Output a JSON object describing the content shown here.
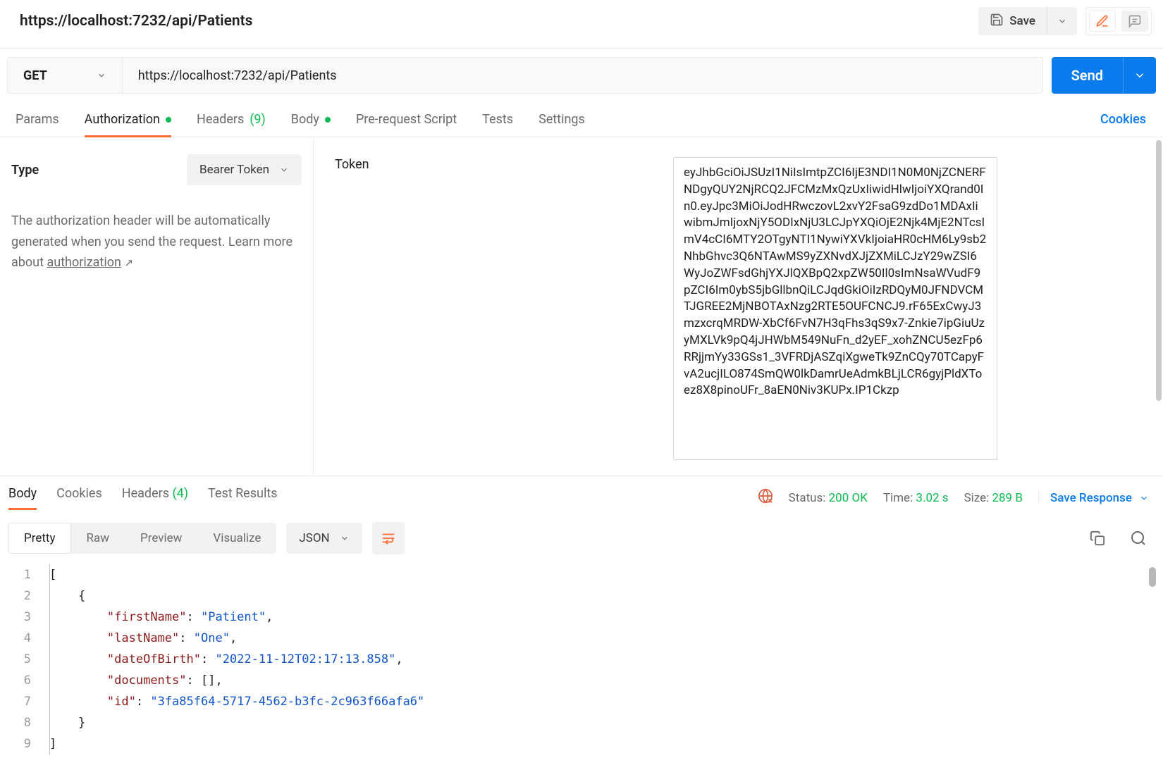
{
  "header": {
    "title": "https://localhost:7232/api/Patients",
    "save_label": "Save"
  },
  "request": {
    "method": "GET",
    "url": "https://localhost:7232/api/Patients",
    "send_label": "Send"
  },
  "req_tabs": {
    "params": "Params",
    "authorization": "Authorization",
    "headers": "Headers",
    "headers_count": "(9)",
    "body": "Body",
    "prerequest": "Pre-request Script",
    "tests": "Tests",
    "settings": "Settings",
    "cookies_link": "Cookies"
  },
  "auth": {
    "type_label": "Type",
    "type_value": "Bearer Token",
    "help_pre": "The authorization header will be automatically generated when you send the request. Learn more about ",
    "help_link": "authorization",
    "token_label": "Token",
    "token_value": "eyJhbGciOiJSUzI1NiIsImtpZCI6IjE3NDI1N0M0NjZCNERFNDgyQUY2NjRCQ2JFCMzMxQzUxIiwidHlwIjoiYXQrand0In0.eyJpc3MiOiJodHRwczovL2xvY2FsaG9zdDo1MDAxIiwibmJmIjoxNjY5ODIxNjU3LCJpYXQiOjE2Njk4MjE2NTcsImV4cCI6MTY2OTgyNTI1NywiYXVkIjoiaHR0cHM6Ly9sb2NhbGhvc3Q6NTAwMS9yZXNvdXJjZXMiLCJzY29wZSI6WyJoZWFsdGhjYXJlQXBpQ2xpZW50Il0sImNsaWVudF9pZCI6Im0ybS5jbGllbnQiLCJqdGkiOiIzRDQyM0JFNDVCMTJGREE2MjNBOTAxNzg2RTE5OUFCNCJ9.rF65ExCwyJ3mzxcrqMRDW-XbCf6FvN7H3qFhs3qS9x7-Znkie7ipGiuUzyMXLVk9pQ4jJHWbM549NuFn_d2yEF_xohZNCU5ezFp6RRjjmYy33GSs1_3VFRDjASZqiXgweTk9ZnCQy70TCapyFvA2ucjILO874SmQW0lkDamrUeAdmkBLjLCR6gyjPldXToez8X8pinoUFr_8aEN0Niv3KUPx.IP1Ckzp"
  },
  "resp_tabs": {
    "body": "Body",
    "cookies": "Cookies",
    "headers": "Headers",
    "headers_count": "(4)",
    "test_results": "Test Results"
  },
  "resp_meta": {
    "status_label": "Status:",
    "status_value": "200 OK",
    "time_label": "Time:",
    "time_value": "3.02 s",
    "size_label": "Size:",
    "size_value": "289 B",
    "save_response": "Save Response"
  },
  "view": {
    "pretty": "Pretty",
    "raw": "Raw",
    "preview": "Preview",
    "visualize": "Visualize",
    "format": "JSON"
  },
  "code": {
    "l1": "[",
    "l2_open": "{",
    "l3_key": "\"firstName\"",
    "l3_val": "\"Patient\"",
    "l4_key": "\"lastName\"",
    "l4_val": "\"One\"",
    "l5_key": "\"dateOfBirth\"",
    "l5_val": "\"2022-11-12T02:17:13.858\"",
    "l6_key": "\"documents\"",
    "l6_val": "[]",
    "l7_key": "\"id\"",
    "l7_val": "\"3fa85f64-5717-4562-b3fc-2c963f66afa6\"",
    "l8_close": "}",
    "l9": "]"
  }
}
